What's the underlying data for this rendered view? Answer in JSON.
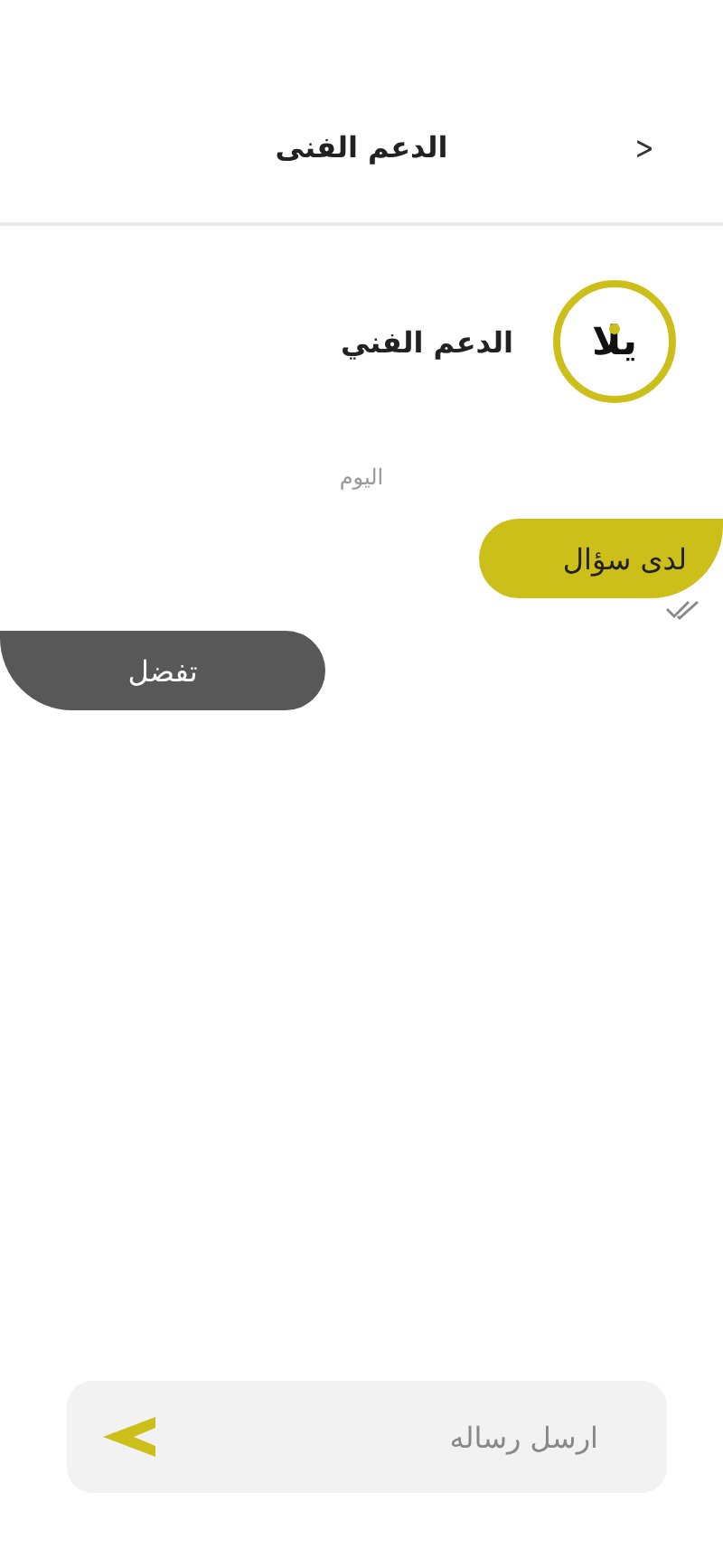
{
  "header": {
    "title": "الدعم الفنى",
    "back": "<"
  },
  "contact": {
    "logo": "يلا",
    "name": "الدعم الفني"
  },
  "date_label": "اليوم",
  "messages": [
    {
      "kind": "sent",
      "text": "لدى سؤال",
      "read": true
    },
    {
      "kind": "received",
      "text": "تفضل"
    }
  ],
  "composer": {
    "placeholder": "ارسل رساله"
  }
}
